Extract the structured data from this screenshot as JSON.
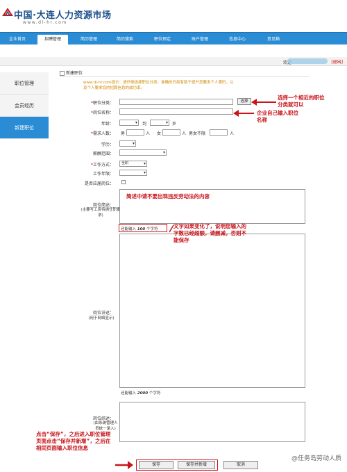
{
  "header": {
    "title": "中国·大连人力资源市场",
    "url": "www.dl-hr.com"
  },
  "nav": {
    "tabs": [
      {
        "label": "企业首页",
        "active": false
      },
      {
        "label": "招聘管理",
        "active": true
      },
      {
        "label": "简历管理",
        "active": false
      },
      {
        "label": "简历搜索",
        "active": false
      },
      {
        "label": "职位预定",
        "active": false
      },
      {
        "label": "账户管理",
        "active": false
      },
      {
        "label": "信息中心",
        "active": false
      },
      {
        "label": "意见箱",
        "active": false
      }
    ]
  },
  "topbar": {
    "welcome": "欢迎",
    "logout": "[退出]"
  },
  "sidebar": {
    "items": [
      {
        "label": "职位管理",
        "active": false
      },
      {
        "label": "会员经历",
        "active": false
      },
      {
        "label": "新建职位",
        "active": true
      }
    ]
  },
  "panel": {
    "title": "新建职位",
    "tip_site": "www.dl-hr.com",
    "tip_text": "提示：请仔细选择职位分类，准确的归类有助于提升您要发个人第历，以及个人要求您的招聘信息的成功率。"
  },
  "form": {
    "category_label": "职位分类：",
    "category_select": "选择",
    "name_label": "岗位名称：",
    "age_label": "年龄：",
    "age_to": "到",
    "age_unit": "岁",
    "headcount_label": "需求人数：",
    "male": "男",
    "female": "女",
    "any": "男女不限",
    "person": "人",
    "edu_label": "学历：",
    "salary_label": "薪酬范围：",
    "worktype_label": "工作方式：",
    "worktype_value": "全职",
    "years_label": "工作年限：",
    "fresh_label": "是否应届岗位：",
    "summary_label": "岗位简述：",
    "summary_hint": "(主要写工资待遇任职要求)",
    "summary_counter_pre": "还能输入",
    "summary_counter_num": "100",
    "summary_counter_post": "个字符",
    "detail_label": "岗位详述：",
    "detail_hint": "(用于网络显示)",
    "detail_counter_pre": "还能输入",
    "detail_counter_num": "2000",
    "detail_counter_post": "个字符",
    "brief_label": "岗位综述：",
    "brief_hint": "(由系统管理人员统一录入)"
  },
  "buttons": {
    "save": "保存",
    "save_new": "保存并新增",
    "cancel": "取消"
  },
  "annotations": {
    "a1": "选择一个相近的职位分类就可以",
    "a2": "企业自己输入职位名称",
    "a3": "简述中请不要出现违反劳动法的内容",
    "a4": "文字如果变化了，说明您输入的字数已经超额，请删减，否则不能保存",
    "a5": "点击“保存”，之后进入职位管理页面点击“保存并新增”，之后在相同页面输入职位信息"
  },
  "watermark": "@任务岛劳动人质",
  "colors": {
    "nav": "#2a8cd4",
    "annotation": "#c8141a",
    "tip": "#d08a00"
  }
}
